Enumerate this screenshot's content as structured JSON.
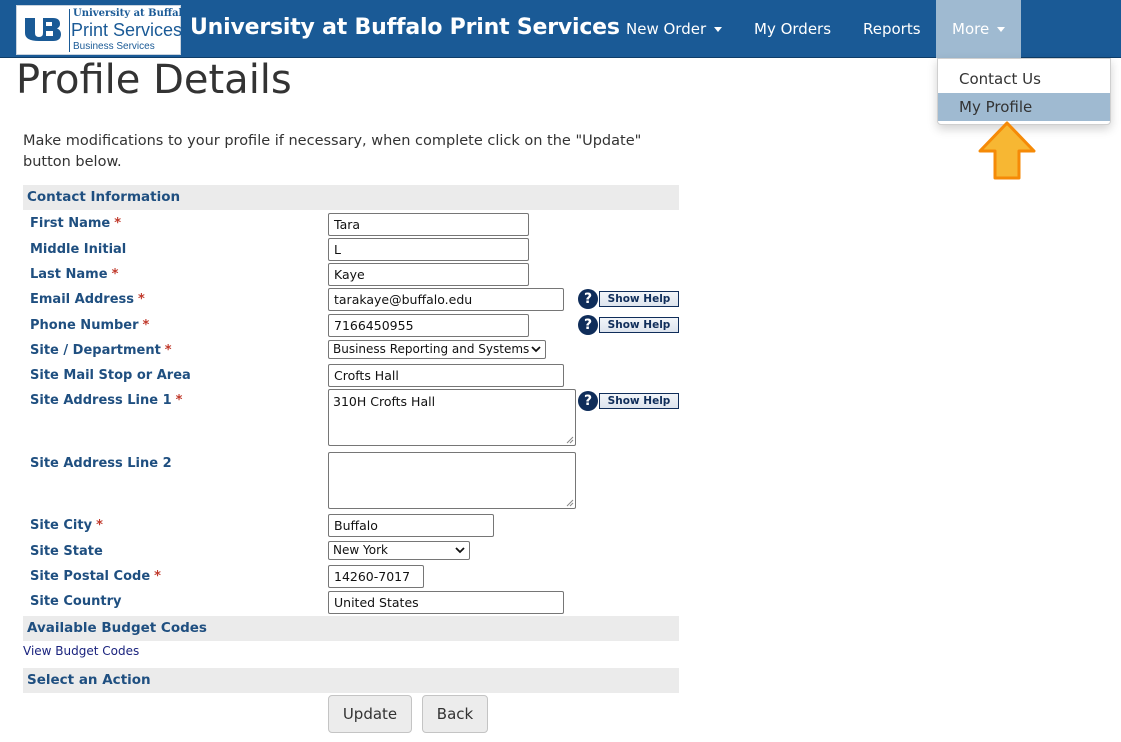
{
  "header": {
    "logo_line1": "University at Buffalo",
    "logo_line2": "Print Services",
    "logo_line3": "Business Services",
    "brand": "University at Buffalo Print Services",
    "nav": {
      "new_order": "New Order",
      "my_orders": "My Orders",
      "reports": "Reports",
      "more": "More"
    }
  },
  "dropdown": {
    "items": [
      {
        "label": "Contact Us"
      },
      {
        "label": "My Profile",
        "selected": true
      }
    ]
  },
  "page": {
    "title": "Profile Details",
    "intro": "Make modifications to your profile if necessary, when complete click on the \"Update\" button below."
  },
  "sections": {
    "contact": "Contact Information",
    "budget": "Available Budget Codes",
    "action": "Select an Action"
  },
  "fields": {
    "first_name": {
      "label": "First Name",
      "value": "Tara",
      "required": "*"
    },
    "middle_initial": {
      "label": "Middle Initial",
      "value": "L"
    },
    "last_name": {
      "label": "Last Name",
      "value": "Kaye",
      "required": "*"
    },
    "email": {
      "label": "Email Address",
      "value": "tarakaye@buffalo.edu",
      "required": "*"
    },
    "phone": {
      "label": "Phone Number",
      "value": "7166450955",
      "required": "*"
    },
    "department": {
      "label": "Site / Department",
      "value": "Business Reporting and Systems",
      "required": "*"
    },
    "mail_stop": {
      "label": "Site Mail Stop or Area",
      "value": "Crofts Hall"
    },
    "address1": {
      "label": "Site Address Line 1",
      "value": "310H Crofts Hall",
      "required": "*"
    },
    "address2": {
      "label": "Site Address Line 2",
      "value": ""
    },
    "city": {
      "label": "Site City",
      "value": "Buffalo",
      "required": "*"
    },
    "state": {
      "label": "Site State",
      "value": "New York"
    },
    "postal": {
      "label": "Site Postal Code",
      "value": "14260-7017",
      "required": "*"
    },
    "country": {
      "label": "Site Country",
      "value": "United States"
    }
  },
  "help": {
    "label": "Show Help",
    "icon": "question-icon"
  },
  "budget_link": "View Budget Codes",
  "buttons": {
    "update": "Update",
    "back": "Back"
  },
  "colors": {
    "navbar": "#1a5a96",
    "active_nav": "#9fbad1",
    "label": "#1f4f80",
    "required": "#c0392b",
    "arrow": "#f7b733"
  }
}
